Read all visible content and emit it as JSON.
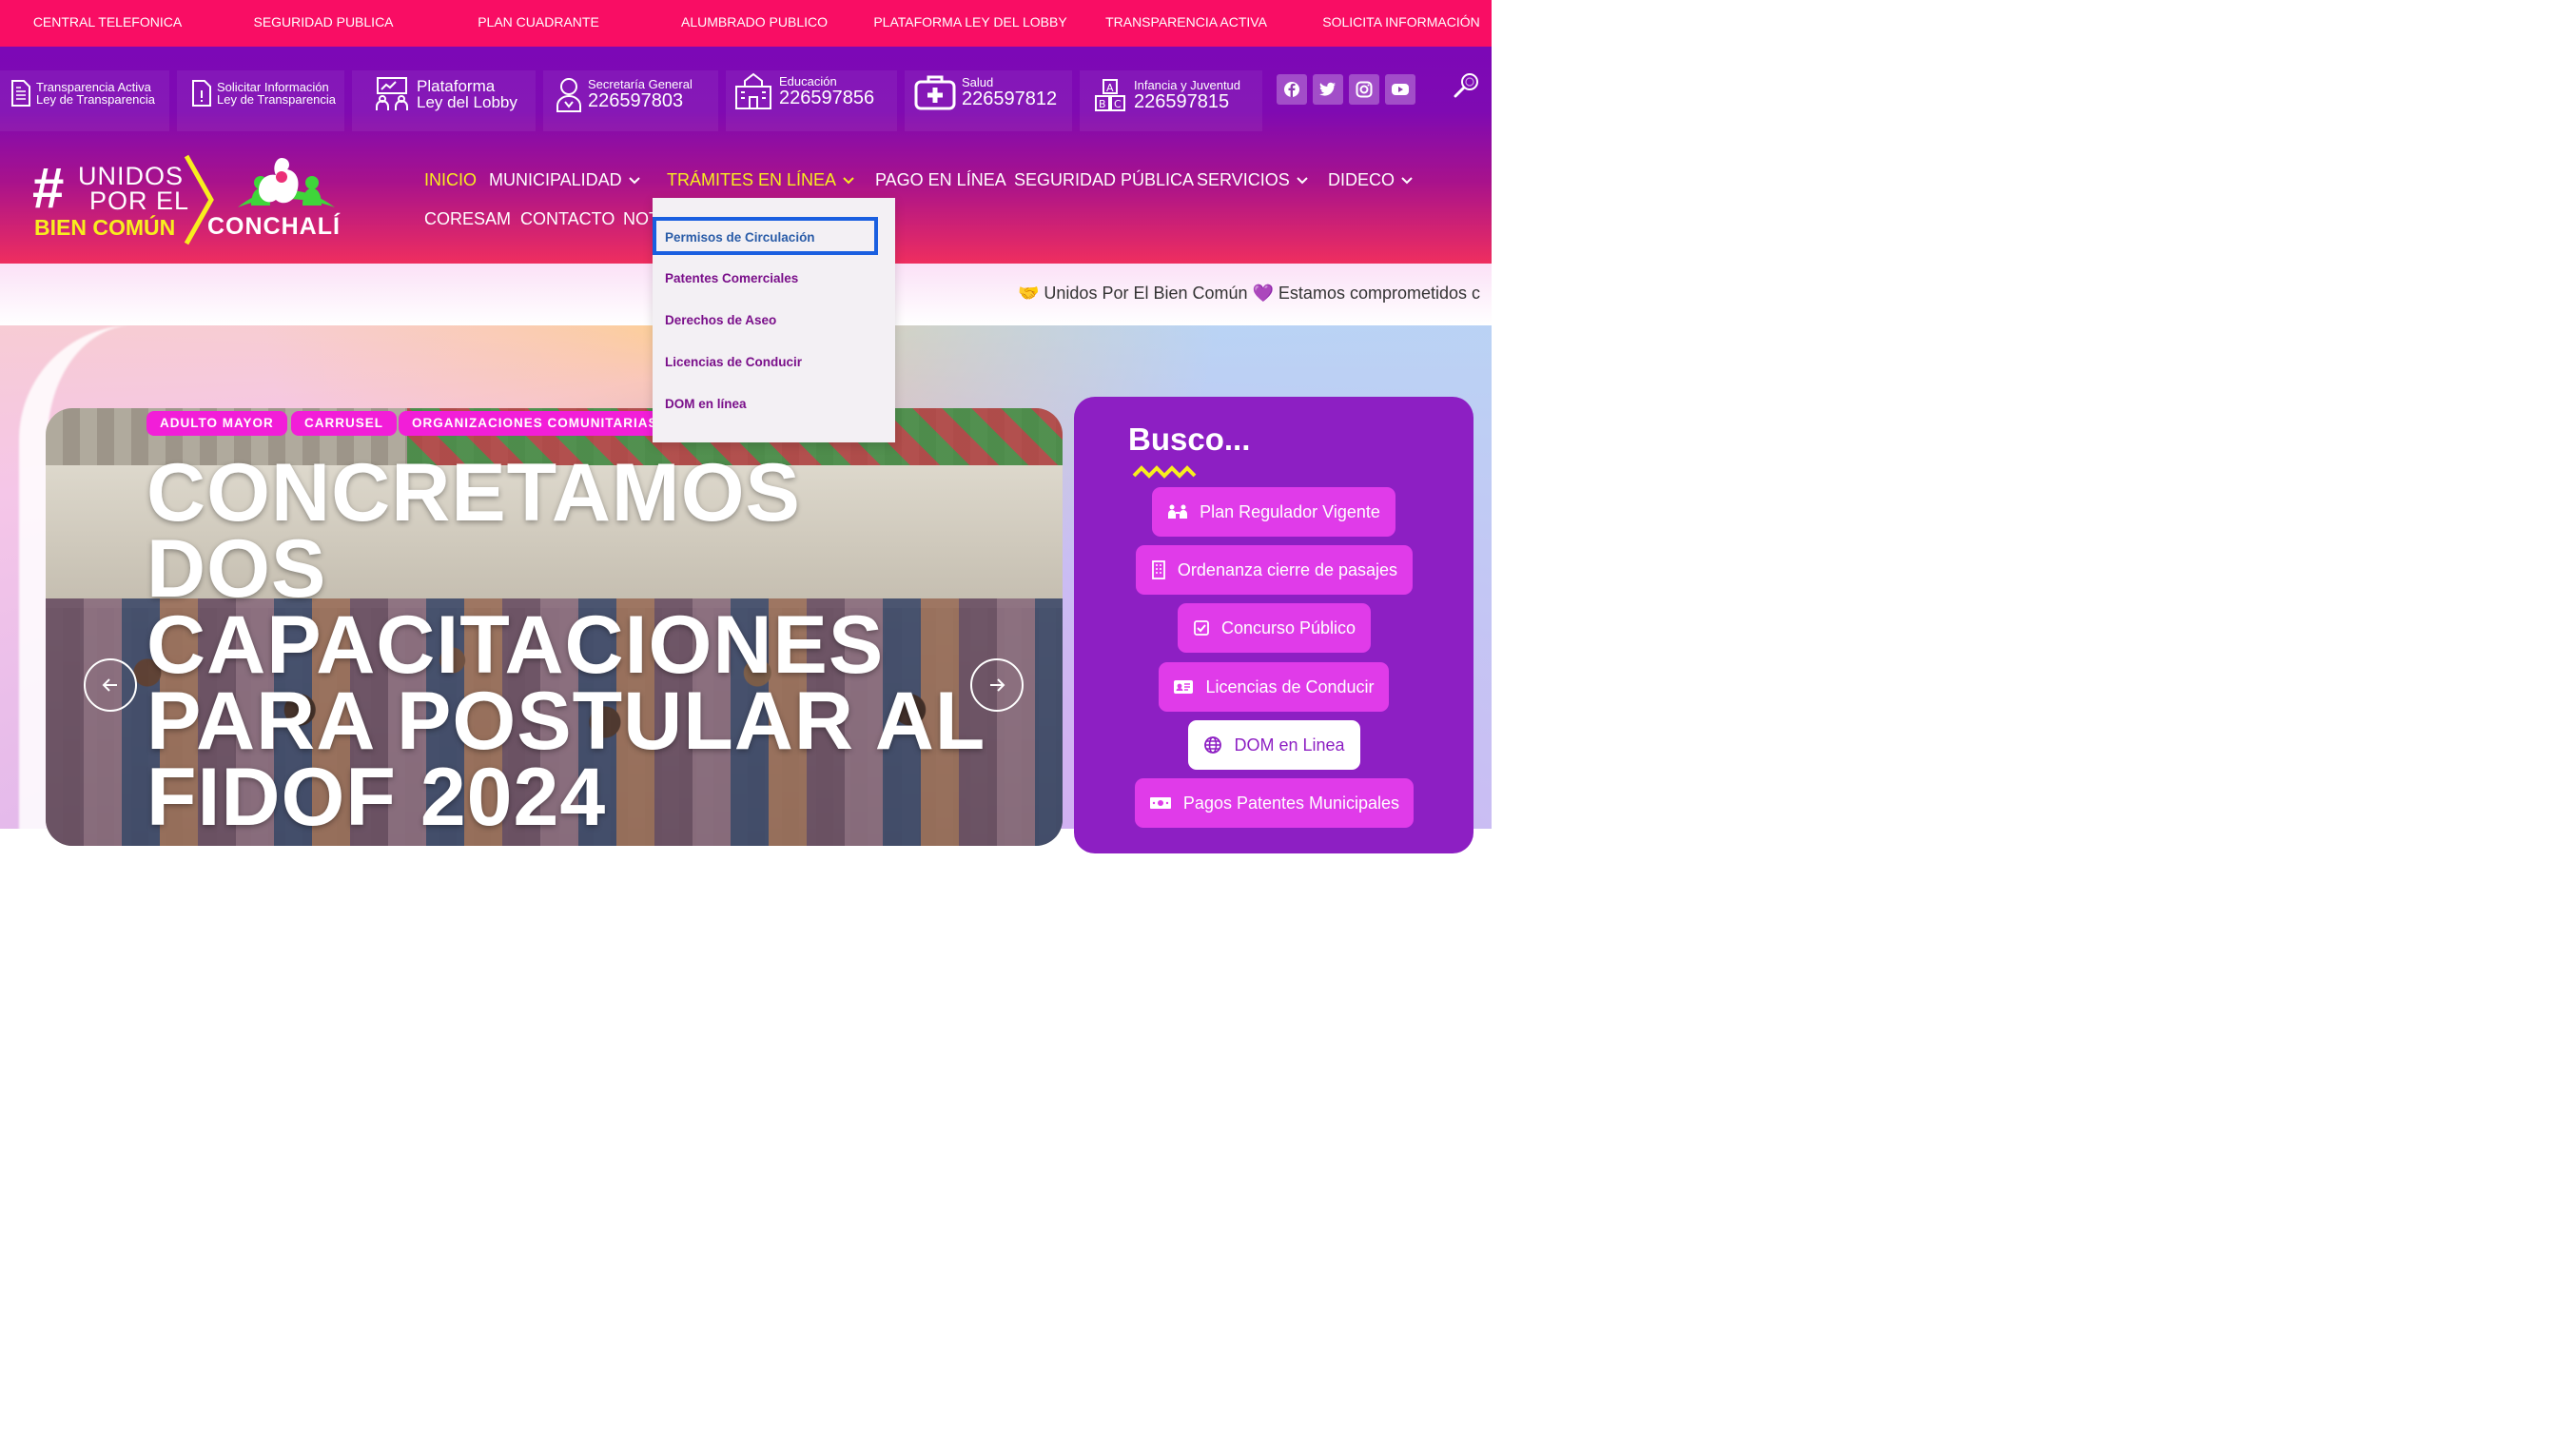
{
  "top_links": [
    "CENTRAL TELEFONICA",
    "SEGURIDAD PUBLICA",
    "PLAN CUADRANTE",
    "ALUMBRADO PUBLICO",
    "PLATAFORMA LEY DEL LOBBY",
    "TRANSPARENCIA ACTIVA",
    "SOLICITA INFORMACIÓN"
  ],
  "quick": {
    "transparencia": {
      "line1": "Transparencia Activa",
      "line2": "Ley de Transparencia"
    },
    "solicitar": {
      "line1": "Solicitar Información",
      "line2": "Ley de Transparencia"
    },
    "lobby": {
      "line1": "Plataforma",
      "line2": "Ley del Lobby"
    },
    "secretaria": {
      "label": "Secretaría General",
      "phone": "226597803"
    },
    "educacion": {
      "label": "Educación",
      "phone": "226597856"
    },
    "salud": {
      "label": "Salud",
      "phone": "226597812"
    },
    "infancia": {
      "label": "Infancia y Juventud",
      "phone": "226597815"
    }
  },
  "logo": {
    "hash": "#",
    "line1": "UNIDOS",
    "line2": "POR EL",
    "line3": "BIEN COMÚN",
    "city": "CONCHALÍ"
  },
  "nav": {
    "inicio": "INICIO",
    "municipalidad": "MUNICIPALIDAD",
    "tramites": "TRÁMITES EN LÍNEA",
    "pago": "PAGO EN LÍNEA",
    "seguridad": "SEGURIDAD PÚBLICA",
    "servicios": "SERVICIOS",
    "dideco": "DIDECO",
    "coresam": "CORESAM",
    "contacto": "CONTACTO",
    "noticias": "NOT"
  },
  "dropdown": [
    "Permisos de Circulación",
    "Patentes Comerciales",
    "Derechos de Aseo",
    "Licencias de Conducir",
    "DOM en línea"
  ],
  "marquee": "🤝 Unidos Por El Bien Común 💜 Estamos comprometidos c",
  "tags": [
    "ADULTO MAYOR",
    "CARRUSEL",
    "ORGANIZACIONES COMUNITARIAS"
  ],
  "headline": "CONCRETAMOS DOS CAPACITACIONES PARA POSTULAR AL FIDOF 2024",
  "busco": {
    "title": "Busco...",
    "buttons": [
      "Plan Regulador Vigente",
      "Ordenanza cierre de pasajes",
      "Concurso Público",
      "Licencias de Conducir",
      "DOM en Linea",
      "Pagos Patentes Municipales"
    ]
  },
  "colors": {
    "accent_pink": "#f90d64",
    "header_purple": "#7c08b6",
    "active_yellow": "#f8ee1e",
    "busco_purple": "#8d1fc3",
    "button_pink": "#e03be9",
    "focus_blue": "#1a5fe0"
  }
}
